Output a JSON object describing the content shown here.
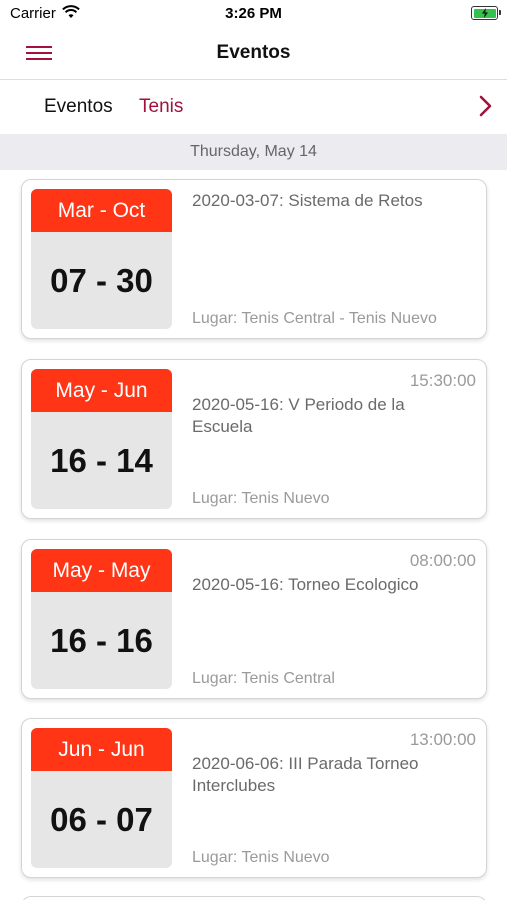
{
  "status_bar": {
    "carrier": "Carrier",
    "time": "3:26 PM"
  },
  "nav": {
    "title": "Eventos"
  },
  "tabs": [
    {
      "label": "Eventos"
    },
    {
      "label": "Tenis"
    }
  ],
  "date_header": "Thursday, May 14",
  "events": [
    {
      "months": "Mar - Oct",
      "days": "07 - 30",
      "time": "",
      "title": "2020-03-07: Sistema de Retos",
      "place": "Lugar: Tenis Central - Tenis Nuevo"
    },
    {
      "months": "May - Jun",
      "days": "16 - 14",
      "time": "15:30:00",
      "title": "2020-05-16: V Periodo de la Escuela",
      "place": "Lugar: Tenis Nuevo"
    },
    {
      "months": "May - May",
      "days": "16 - 16",
      "time": "08:00:00",
      "title": "2020-05-16: Torneo Ecologico",
      "place": "Lugar: Tenis Central"
    },
    {
      "months": "Jun - Jun",
      "days": "06 - 07",
      "time": "13:00:00",
      "title": "2020-06-06: III Parada Torneo Interclubes",
      "place": "Lugar: Tenis Nuevo"
    }
  ],
  "colors": {
    "accent": "#a3123e",
    "calendar_header": "#ff3516",
    "battery": "#32c24d"
  }
}
